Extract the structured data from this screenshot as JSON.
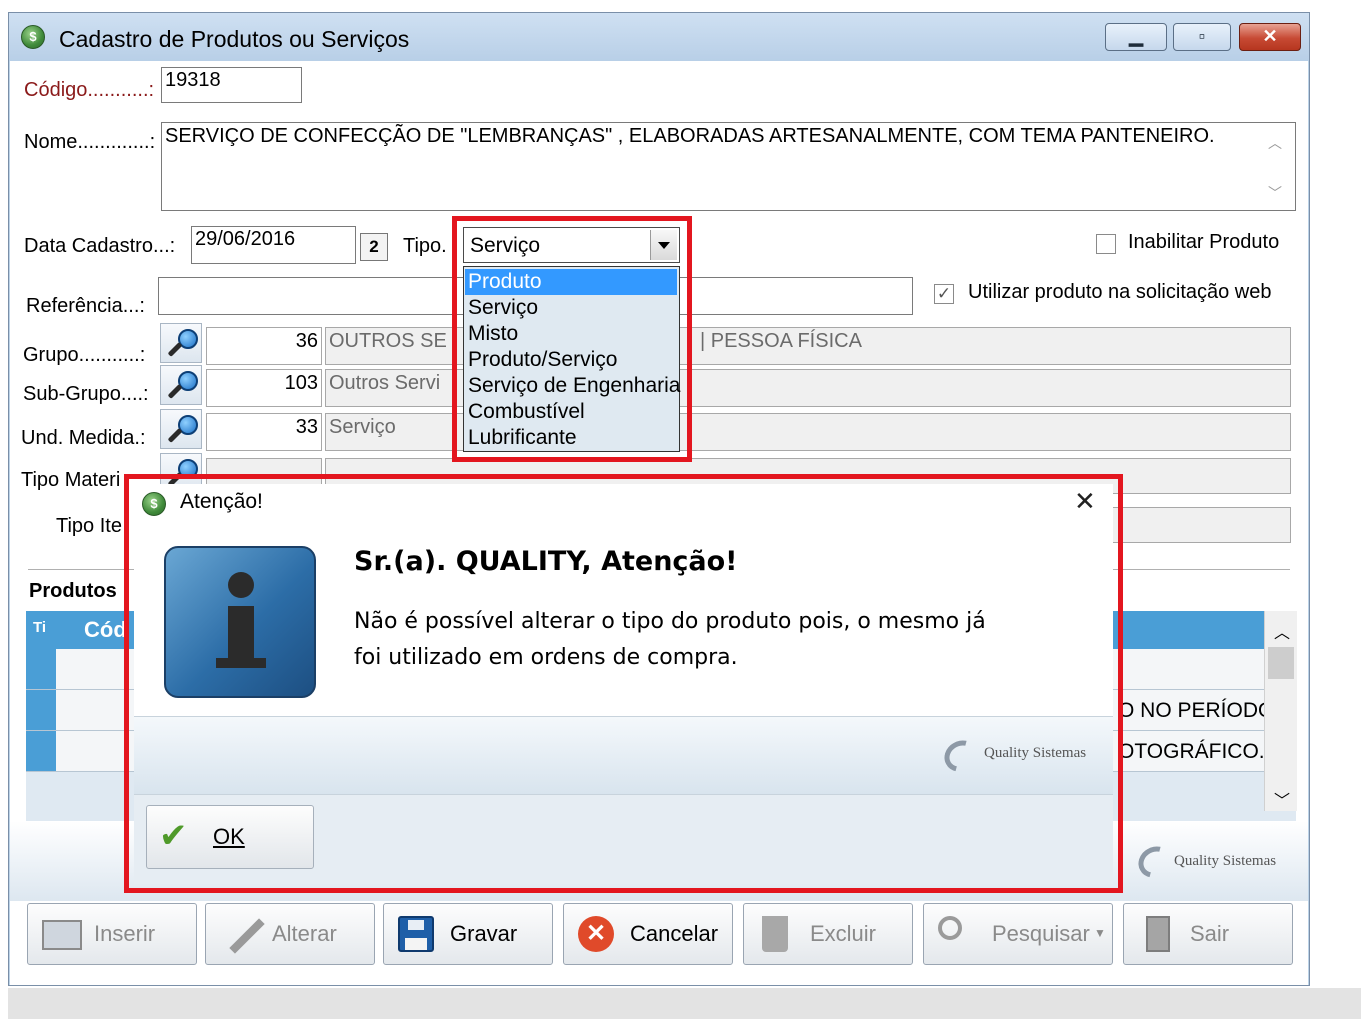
{
  "window": {
    "title": "Cadastro de Produtos ou Serviços",
    "minimize_glyph": "▁",
    "maximize_glyph": "▫",
    "close_glyph": "✕"
  },
  "form": {
    "codigo_label": "Código...........:",
    "codigo_value": "19318",
    "nome_label": "Nome.............:",
    "nome_value": "SERVIÇO DE CONFECÇÃO DE \"LEMBRANÇAS\" , ELABORADAS ARTESANALMENTE, COM TEMA PANTENEIRO.",
    "data_label": "Data Cadastro...:",
    "data_value": "29/06/2016",
    "calendar_glyph": "2",
    "tipo_label": "Tipo.",
    "tipo_value": "Serviço",
    "inabilitar_label": "Inabilitar Produto",
    "web_label": "Utilizar produto na solicitação web",
    "web_check_glyph": "✓",
    "referencia_label": "Referência...:",
    "grupo_label": "Grupo...........:",
    "grupo_code": "36",
    "grupo_desc": "OUTROS SE",
    "grupo_desc_tail": "| PESSOA FÍSICA",
    "subgrupo_label": "Sub-Grupo....:",
    "subgrupo_code": "103",
    "subgrupo_desc": "Outros Servi",
    "und_label": "Und. Medida.:",
    "und_code": "33",
    "und_desc": "Serviço",
    "tipo_material_label": "Tipo Materi",
    "tipo_item_label": "Tipo Ite",
    "produtos_section": "Produtos",
    "col_ti": "Ti",
    "col_cod": "Cód",
    "row2_text": "O NO PERÍODO",
    "row3_text": "OTOGRÁFICO."
  },
  "dropdown": {
    "options": [
      "Produto",
      "Serviço",
      "Misto",
      "Produto/Serviço",
      "Serviço de Engenharia",
      "Combustível",
      "Lubrificante"
    ],
    "selected": "Produto"
  },
  "dialog": {
    "title": "Atenção!",
    "close_glyph": "✕",
    "heading": "Sr.(a). QUALITY, Atenção!",
    "message_line1": "Não é possível alterar o tipo do produto pois, o mesmo já",
    "message_line2": "foi utilizado em ordens de compra.",
    "ok_label": "OK",
    "brand": "Quality Sistemas"
  },
  "toolbar": {
    "inserir": "Inserir",
    "alterar": "Alterar",
    "gravar": "Gravar",
    "cancelar": "Cancelar",
    "excluir": "Excluir",
    "pesquisar": "Pesquisar",
    "sair": "Sair"
  },
  "brand": "Quality Sistemas",
  "colors": {
    "highlight": "#e3161f",
    "selection": "#3399ff",
    "grid_header": "#4a9ed6"
  }
}
